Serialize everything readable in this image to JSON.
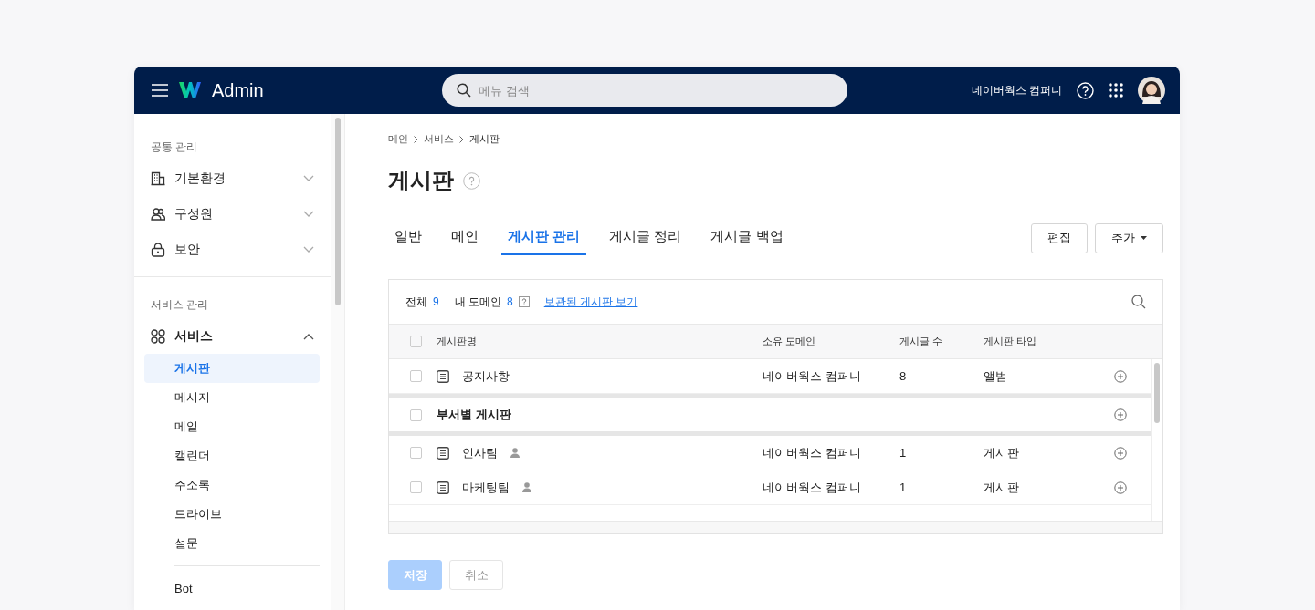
{
  "header": {
    "app_name": "Admin",
    "search": {
      "placeholder": "메뉴 검색"
    },
    "company": "네이버웍스 컴퍼니"
  },
  "sidebar": {
    "sections": [
      {
        "label": "공통 관리",
        "items": [
          {
            "label": "기본환경",
            "expanded": false
          },
          {
            "label": "구성원",
            "expanded": false
          },
          {
            "label": "보안",
            "expanded": false
          }
        ]
      },
      {
        "label": "서비스 관리",
        "items": [
          {
            "label": "서비스",
            "expanded": true,
            "children": [
              {
                "label": "게시판",
                "selected": true
              },
              {
                "label": "메시지",
                "selected": false
              },
              {
                "label": "메일",
                "selected": false
              },
              {
                "label": "캘린더",
                "selected": false
              },
              {
                "label": "주소록",
                "selected": false
              },
              {
                "label": "드라이브",
                "selected": false
              },
              {
                "label": "설문",
                "selected": false
              }
            ]
          }
        ],
        "more_items": [
          {
            "label": "Bot",
            "selected": false
          }
        ]
      }
    ]
  },
  "breadcrumb": [
    "메인",
    "서비스",
    "게시판"
  ],
  "title": "게시판",
  "tabs": [
    {
      "label": "일반",
      "selected": false
    },
    {
      "label": "메인",
      "selected": false
    },
    {
      "label": "게시판 관리",
      "selected": true
    },
    {
      "label": "게시글 정리",
      "selected": false
    },
    {
      "label": "게시글 백업",
      "selected": false
    }
  ],
  "actions": [
    {
      "label": "편집",
      "kind": "plain"
    },
    {
      "label": "추가",
      "kind": "dropdown"
    }
  ],
  "table": {
    "summary": {
      "total_label": "전체",
      "total": "9",
      "domain_label": "내 도메인",
      "domain_count": "8",
      "link": "보관된 게시판 보기"
    },
    "header_checked": false,
    "columns": [
      "게시판명",
      "소유 도메인",
      "게시글 수",
      "게시판 타입"
    ],
    "rows": [
      {
        "kind": "board",
        "checked": false,
        "name": "공지사항",
        "member_only": false,
        "domain": "네이버웍스 컴퍼니",
        "count": "8",
        "type": "앨범"
      },
      {
        "kind": "group",
        "checked": false,
        "name": "부서별 게시판"
      },
      {
        "kind": "board",
        "checked": false,
        "name": "인사팀",
        "member_only": true,
        "domain": "네이버웍스 컴퍼니",
        "count": "1",
        "type": "게시판"
      },
      {
        "kind": "board",
        "checked": false,
        "name": "마케팅팀",
        "member_only": true,
        "domain": "네이버웍스 컴퍼니",
        "count": "1",
        "type": "게시판"
      }
    ]
  },
  "footer": [
    {
      "label": "저장",
      "kind": "primary",
      "disabled": true
    },
    {
      "label": "취소",
      "kind": "secondary",
      "disabled": true
    }
  ]
}
